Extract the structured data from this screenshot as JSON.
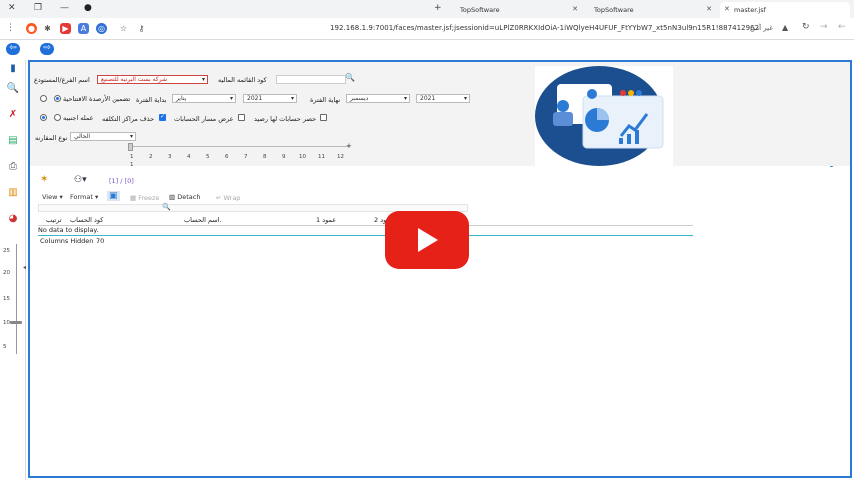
{
  "browser": {
    "tabs": [
      {
        "title": "TopSoftware"
      },
      {
        "title": "TopSoftware"
      },
      {
        "title": "master.jsf"
      }
    ],
    "new_tab": "+",
    "url": "192.168.1.9:7001/faces/master.jsf;jsessionid=uLPlZ0RRKXIdOiA-1iWQlyeH4UFUF_FtYYbW7_xt5nN3ul9n15R1!887412962",
    "security_label": "غير آمن"
  },
  "form": {
    "branch_label": "اسم الفرع/المستودع",
    "branch_value": "شركه بست البرنيه للتصنيع",
    "list_code_label": "كود القائمه الماليه",
    "opening_balances_label": "تضمين الأرصدة الافتتاحية",
    "period_start_label": "بداية الفترة",
    "period_start_month": "يناير",
    "period_start_year": "2021",
    "period_end_label": "نهاية الفترة",
    "period_end_month": "ديسمبر",
    "period_end_year": "2021",
    "foreign_currency_label": "عمله اجنبيه",
    "delete_cost_centers_label": "حذف مراكز التكلفه",
    "show_accounts_path_label": "عرض مسار الحسابات",
    "balance_accounts_label": "حصر حسابات لها رصيد",
    "comparison_type_label": "نوع المقارنه",
    "comparison_type_value": "الحالي",
    "slider_ticks": [
      "1",
      "2",
      "3",
      "4",
      "5",
      "6",
      "7",
      "8",
      "9",
      "10",
      "11",
      "12"
    ],
    "slider_value": "1"
  },
  "grid": {
    "pagination": "[1] / [0]",
    "view_label": "View",
    "format_label": "Format",
    "freeze_label": "Freeze",
    "detach_label": "Detach",
    "wrap_label": "Wrap",
    "columns": [
      "ترتيب",
      "كود الحساب",
      "اسم الحساب.",
      "عمود 1",
      "عمود 2"
    ],
    "empty_message": "No data to display.",
    "columns_hidden_label": "Columns Hidden",
    "columns_hidden_count": "70"
  },
  "left_ruler": [
    "25",
    "20",
    "15",
    "10",
    "5"
  ],
  "colors": {
    "accent": "#2b7bd6",
    "play_button": "#e62117",
    "logo_circle": "#1c4f8f"
  }
}
